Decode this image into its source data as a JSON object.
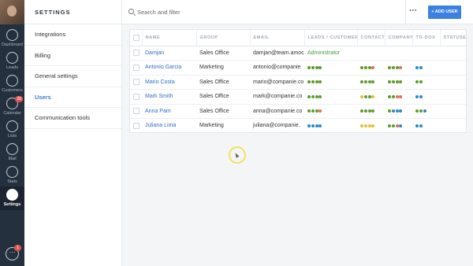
{
  "rail": {
    "items": [
      {
        "label": "Dashboard",
        "icon": "dashboard-icon",
        "badge": ""
      },
      {
        "label": "Leads",
        "icon": "dollar-icon",
        "badge": ""
      },
      {
        "label": "Customers",
        "icon": "customers-icon",
        "badge": ""
      },
      {
        "label": "Calendar",
        "icon": "calendar-icon",
        "badge": "28"
      },
      {
        "label": "Lists",
        "icon": "lists-icon",
        "badge": ""
      },
      {
        "label": "Mail",
        "icon": "mail-icon",
        "badge": ""
      },
      {
        "label": "Stats",
        "icon": "stats-icon",
        "badge": ""
      },
      {
        "label": "Settings",
        "icon": "settings-icon",
        "badge": ""
      }
    ],
    "chat_badge": "1",
    "chat_icon": "ellipsis-chat-icon"
  },
  "settings": {
    "title": "SETTINGS",
    "items": [
      {
        "label": "Integrations"
      },
      {
        "label": "Billing"
      },
      {
        "label": "General settings"
      },
      {
        "label": "Users"
      },
      {
        "label": "Communication tools"
      }
    ],
    "active_index": 3
  },
  "toolbar": {
    "search_placeholder": "Search and filter",
    "more_label": "⋯",
    "add_user_label": "+ ADD USER"
  },
  "colors": {
    "accent": "#3b82e0",
    "link": "#2f6fc4",
    "role_green": "#3f9c35",
    "dot_green": "#5e9a2e",
    "dot_red": "#e06b5c",
    "dot_yellow": "#e0c12c",
    "dot_blue": "#2b86c9"
  },
  "table": {
    "headers": [
      "NAME",
      "GROUP",
      "EMAIL",
      "LEADS / CUSTOMER",
      "CONTACT",
      "COMPANY",
      "TO-DOS",
      "STATUSES"
    ],
    "rows": [
      {
        "name": "Damjan",
        "group": "Sales Office",
        "email": "damjan@team.amoc",
        "role": "Administrator",
        "leads": [],
        "contacts": [],
        "company": [],
        "todos": []
      },
      {
        "name": "Antonio Garcia",
        "group": "Marketing",
        "email": "antonio@companie",
        "role": "",
        "leads": [
          "green",
          "green",
          "green",
          "green"
        ],
        "contacts": [
          "green",
          "green",
          "green",
          "red"
        ],
        "company": [
          "green",
          "green",
          "green",
          "red"
        ],
        "todos": [
          "blue",
          "blue"
        ]
      },
      {
        "name": "Mario Costa",
        "group": "Sales Office",
        "email": "mario@companie.co",
        "role": "",
        "leads": [
          "green",
          "green",
          "green",
          "green"
        ],
        "contacts": [
          "green",
          "green",
          "green",
          "green"
        ],
        "company": [
          "green",
          "green",
          "green",
          "green"
        ],
        "todos": [
          "green",
          "green"
        ]
      },
      {
        "name": "Mark Smith",
        "group": "Sales Office",
        "email": "mark@companie.co",
        "role": "",
        "leads": [
          "green",
          "green",
          "green",
          "green"
        ],
        "contacts": [
          "yellow",
          "green",
          "green",
          "yellow"
        ],
        "company": [
          "green",
          "green",
          "red",
          "red"
        ],
        "todos": [
          "blue",
          "blue"
        ]
      },
      {
        "name": "Anna Pam",
        "group": "Sales Office",
        "email": "anna@companie.co",
        "role": "",
        "leads": [
          "green",
          "green",
          "green",
          "red"
        ],
        "contacts": [
          "green",
          "green",
          "green",
          "green"
        ],
        "company": [
          "green",
          "blue",
          "blue",
          "blue"
        ],
        "todos": [
          "green",
          "green",
          "blue"
        ]
      },
      {
        "name": "Juliana Lima",
        "group": "Marketing",
        "email": "juliana@companie.",
        "role": "",
        "leads": [
          "blue",
          "blue",
          "blue",
          "blue"
        ],
        "contacts": [
          "yellow",
          "yellow",
          "yellow",
          "yellow"
        ],
        "company": [
          "green",
          "green",
          "red",
          "blue"
        ],
        "todos": [
          "blue",
          "blue"
        ]
      }
    ]
  }
}
